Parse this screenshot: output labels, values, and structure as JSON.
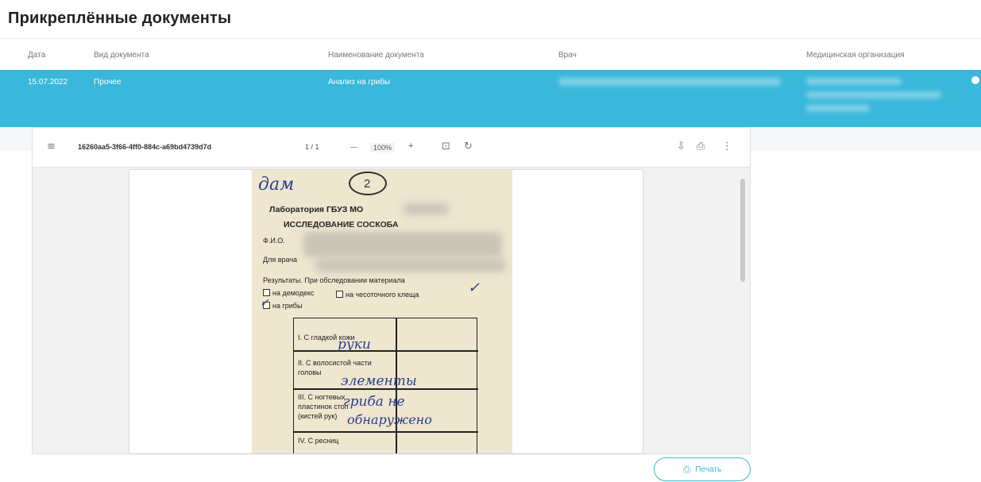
{
  "page": {
    "title": "Прикреплённые документы"
  },
  "table": {
    "columns": [
      "Дата",
      "Вид документа",
      "Наименование документа",
      "Врач",
      "Медицинская организация"
    ],
    "selected_row": {
      "date": "15.07.2022",
      "doc_type": "Прочее",
      "doc_name": "Анализ на грибы"
    }
  },
  "viewer": {
    "menu_icon": "menu-icon",
    "file_name": "16260aa5-3f66-4ff0-884c-a69bd4739d7d",
    "page_indicator": "1 / 1",
    "zoom_minus": "—",
    "zoom_value": "100%",
    "zoom_plus": "+",
    "icons": {
      "fit": "fit-page-icon",
      "rotate": "rotate-icon",
      "download": "download-icon",
      "print": "print-icon",
      "more": "more-vertical-icon"
    },
    "document": {
      "header_handwriting": "дам",
      "circle_number": "2",
      "lab_title": "Лаборатория ГБУЗ МО",
      "study_title": "ИССЛЕДОВАНИЕ СОСКОБА",
      "fio_label": "Ф.И.О.",
      "doctor_label": "Для врача",
      "results_label": "Результаты. При обследовании материала",
      "opt_demodex": "на демодекс",
      "opt_mite": "на чесоточного клеща",
      "opt_fungi": "на грибы",
      "row1": "I. С гладкой кожи",
      "row2_a": "II. С волосистой части",
      "row2_b": "головы",
      "row3_a": "III. С ногтевых",
      "row3_b": "пластинок стоп",
      "row3_c": "(кистей рук)",
      "row4": "IV. С ресниц",
      "hw_row1": "руки",
      "hw_row2": "элементы",
      "hw_row3": "гриба не",
      "hw_row3b": "обнаружено"
    }
  },
  "actions": {
    "print_label": "Печать"
  },
  "colors": {
    "accent": "#3ab8db"
  }
}
